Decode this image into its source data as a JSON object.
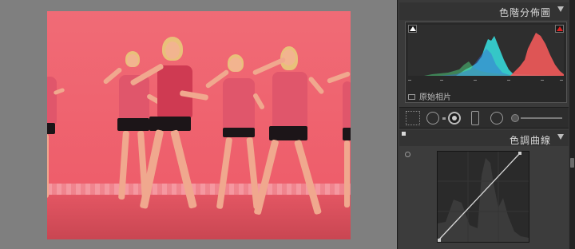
{
  "histogram_panel": {
    "title": "色階分佈圖",
    "original_photo_label": "原始相片",
    "collapse_icon": "triangle-down-icon",
    "shadow_clip_icon": "shadow-clipping-icon",
    "highlight_clip_icon": "highlight-clipping-icon",
    "highlight_clip_color": "#e02020"
  },
  "tool_strip": {
    "tools": [
      "crop-overlay-icon",
      "crop-tool-icon",
      "spot-removal-icon",
      "graduated-filter-icon",
      "radial-filter-icon",
      "adjustment-brush-icon"
    ]
  },
  "tone_curve_panel": {
    "title": "色調曲線",
    "collapse_icon": "triangle-down-icon",
    "target_adjust_icon": "target-adjustment-icon"
  },
  "colors": {
    "canvas_background": "#7f7f7f",
    "photo_tint": "#ef5f6c",
    "histogram_cyan": "#36d8d8",
    "histogram_red": "#f25a5a",
    "panel_background": "#3a3a3a"
  }
}
